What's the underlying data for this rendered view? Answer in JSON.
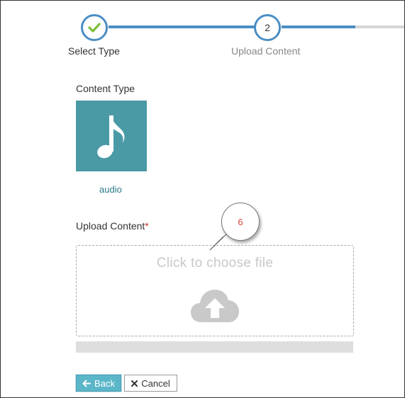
{
  "stepper": {
    "steps": [
      {
        "label": "Select Type",
        "state": "completed",
        "icon": "check-icon"
      },
      {
        "label": "Upload Content",
        "number": "2",
        "state": "current"
      }
    ],
    "colors": {
      "active": "#4a8ec4",
      "inactive": "#d6d6d6",
      "check": "#7cbf3a"
    }
  },
  "content_type": {
    "label": "Content Type",
    "selected": {
      "name": "audio",
      "icon": "music-note-icon",
      "tile_color": "#4a9aa6"
    }
  },
  "upload": {
    "label": "Upload Content",
    "required_marker": "*",
    "dropzone_text": "Click to choose file",
    "icon": "cloud-upload-icon",
    "progress": 0
  },
  "buttons": {
    "back_label": "Back",
    "back_icon": "arrow-left-icon",
    "cancel_label": "Cancel",
    "cancel_icon": "close-icon"
  },
  "annotation": {
    "number": "6"
  }
}
